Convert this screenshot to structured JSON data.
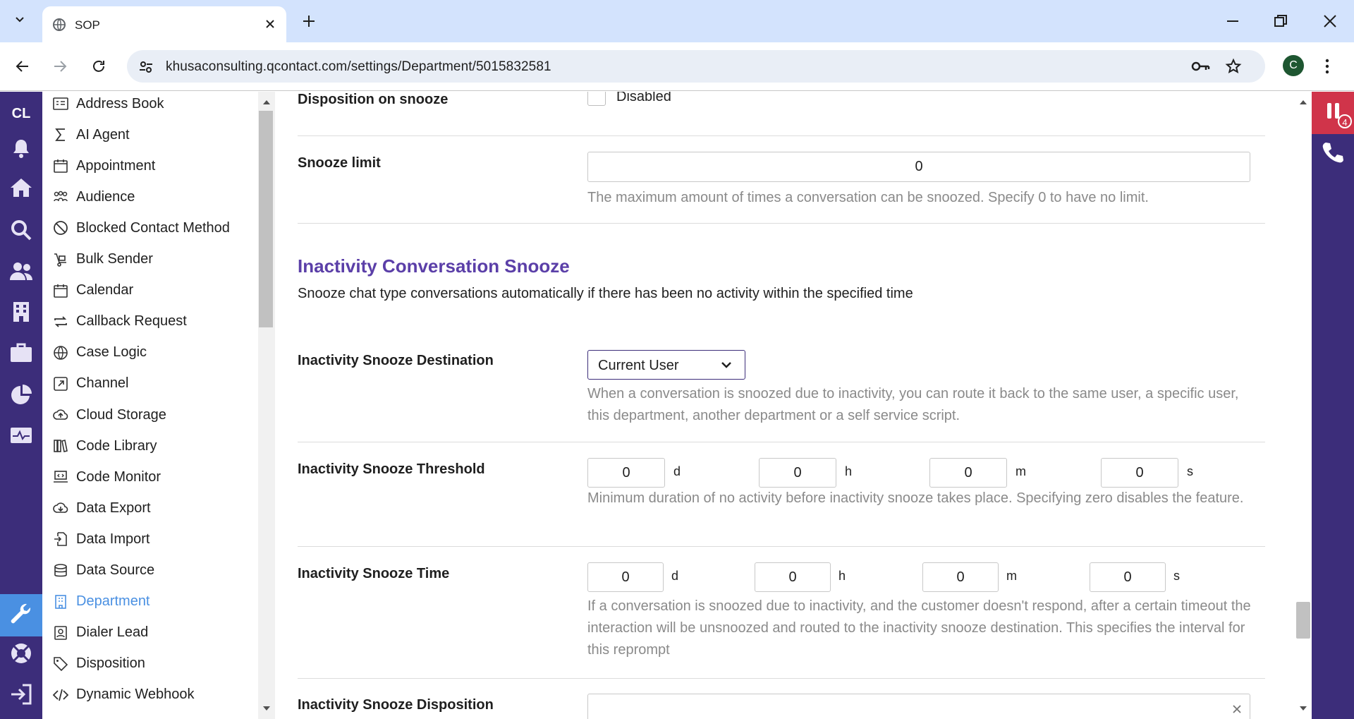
{
  "browser": {
    "tab_title": "SOP",
    "url": "khusaconsulting.qcontact.com/settings/Department/5015832581",
    "profile_initial": "C"
  },
  "app": {
    "logo": "CL",
    "notification_count": "4"
  },
  "sidebar": {
    "items": [
      {
        "label": "Address Book",
        "icon": "address-book-icon"
      },
      {
        "label": "AI Agent",
        "icon": "sigma-icon"
      },
      {
        "label": "Appointment",
        "icon": "calendar-icon"
      },
      {
        "label": "Audience",
        "icon": "people-icon"
      },
      {
        "label": "Blocked Contact Method",
        "icon": "block-icon"
      },
      {
        "label": "Bulk Sender",
        "icon": "dolly-icon"
      },
      {
        "label": "Calendar",
        "icon": "calendar-icon"
      },
      {
        "label": "Callback Request",
        "icon": "repeat-icon"
      },
      {
        "label": "Case Logic",
        "icon": "globe-icon"
      },
      {
        "label": "Channel",
        "icon": "external-link-icon"
      },
      {
        "label": "Cloud Storage",
        "icon": "cloud-upload-icon"
      },
      {
        "label": "Code Library",
        "icon": "books-icon"
      },
      {
        "label": "Code Monitor",
        "icon": "laptop-code-icon"
      },
      {
        "label": "Data Export",
        "icon": "cloud-download-icon"
      },
      {
        "label": "Data Import",
        "icon": "file-import-icon"
      },
      {
        "label": "Data Source",
        "icon": "database-icon"
      },
      {
        "label": "Department",
        "icon": "building-icon",
        "active": true
      },
      {
        "label": "Dialer Lead",
        "icon": "contact-card-icon"
      },
      {
        "label": "Disposition",
        "icon": "tag-icon"
      },
      {
        "label": "Dynamic Webhook",
        "icon": "code-icon"
      }
    ]
  },
  "form": {
    "disposition_on_snooze": {
      "label": "Disposition on snooze",
      "checkbox_label": "Disabled"
    },
    "snooze_limit": {
      "label": "Snooze limit",
      "value": "0",
      "help": "The maximum amount of times a conversation can be snoozed. Specify 0 to have no limit."
    },
    "section": {
      "title": "Inactivity Conversation Snooze",
      "description": "Snooze chat type conversations automatically if there has been no activity within the specified time"
    },
    "destination": {
      "label": "Inactivity Snooze Destination",
      "value": "Current User",
      "help": "When a conversation is snoozed due to inactivity, you can route it back to the same user, a specific user, this department, another department or a self service script."
    },
    "threshold": {
      "label": "Inactivity Snooze Threshold",
      "d": "0",
      "h": "0",
      "m": "0",
      "s": "0",
      "help": "Minimum duration of no activity before inactivity snooze takes place. Specifying zero disables the feature."
    },
    "time": {
      "label": "Inactivity Snooze Time",
      "d": "0",
      "h": "0",
      "m": "0",
      "s": "0",
      "help": "If a conversation is snoozed due to inactivity, and the customer doesn't respond, after a certain timeout the interaction will be unsnoozed and routed to the inactivity snooze destination. This specifies the interval for this reprompt"
    },
    "disposition": {
      "label": "Inactivity Snooze Disposition",
      "value": ""
    },
    "units": {
      "d": "d",
      "h": "h",
      "m": "m",
      "s": "s"
    }
  }
}
